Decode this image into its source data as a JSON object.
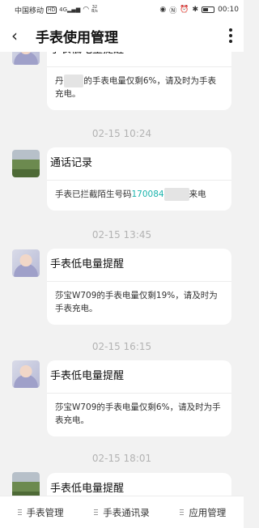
{
  "status_bar": {
    "carrier": "中国移动",
    "hd_badge": "HD",
    "signal": "4G",
    "net_speed_value": "32",
    "net_speed_unit": "B/s",
    "time": "00:10",
    "icons": [
      "signal-icon",
      "wifi-icon",
      "eye-icon",
      "nfc-icon",
      "alarm-icon",
      "bluetooth-icon",
      "battery-icon"
    ]
  },
  "header": {
    "title": "手表使用管理",
    "back_icon": "chevron-left-icon",
    "more_icon": "more-vertical-icon"
  },
  "messages": [
    {
      "timestamp": "",
      "title": "手表低电量提醒",
      "body_prefix": "丹",
      "body_redacted": "xxxx",
      "body_suffix": "的手表电量仅剩6%，请及时为手表充电。",
      "avatar": "person"
    },
    {
      "timestamp": "02-15 10:24",
      "title": "通话记录",
      "body_prefix": "手表已拦截陌生号码",
      "body_link": "170084",
      "body_redacted": "xxxxx",
      "body_suffix": "来电",
      "avatar": "scene"
    },
    {
      "timestamp": "02-15 13:45",
      "title": "手表低电量提醒",
      "body": "莎宝W709的手表电量仅剩19%，请及时为手表充电。",
      "avatar": "person"
    },
    {
      "timestamp": "02-15 16:15",
      "title": "手表低电量提醒",
      "body": "莎宝W709的手表电量仅剩6%，请及时为手表充电。",
      "avatar": "person"
    },
    {
      "timestamp": "02-15 18:01",
      "title": "手表低电量提醒",
      "avatar": "scene"
    }
  ],
  "bottom_nav": [
    {
      "label": "手表管理"
    },
    {
      "label": "手表通讯录"
    },
    {
      "label": "应用管理"
    }
  ],
  "colors": {
    "background": "#f2f2f2",
    "card": "#ffffff",
    "link": "#19b3ac",
    "timestamp": "#b3b3b3"
  }
}
